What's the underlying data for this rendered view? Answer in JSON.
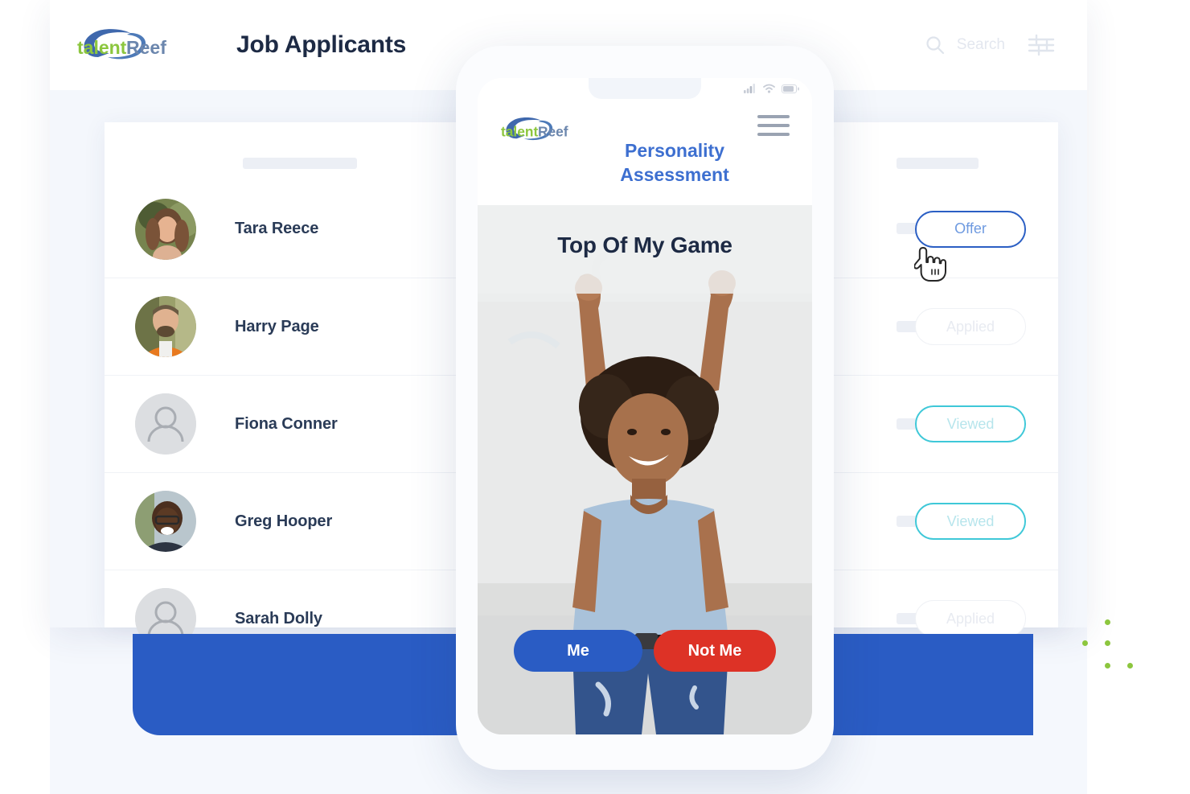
{
  "brand": {
    "logo_text_a": "talent",
    "logo_text_b": "Reef",
    "green": "#8CC63E",
    "blue": "#3f68ad",
    "gray_blue": "#6b86ad"
  },
  "header": {
    "title": "Job Applicants",
    "search_placeholder": "Search",
    "search_icon": "search-icon",
    "filter_icon": "filter-sliders-icon"
  },
  "applicants": [
    {
      "name": "Tara Reece",
      "status": "Offer",
      "status_kind": "offer",
      "avatar": "photo"
    },
    {
      "name": "Harry Page",
      "status": "Applied",
      "status_kind": "applied",
      "avatar": "photo"
    },
    {
      "name": "Fiona Conner",
      "status": "Viewed",
      "status_kind": "viewed",
      "avatar": "placeholder"
    },
    {
      "name": "Greg Hooper",
      "status": "Viewed",
      "status_kind": "viewed",
      "avatar": "photo"
    },
    {
      "name": "Sarah Dolly",
      "status": "Applied",
      "status_kind": "applied",
      "avatar": "placeholder"
    }
  ],
  "status_colors": {
    "offer": "#2B5FC4",
    "applied": "#E8EBF1",
    "viewed": "#3FC8D8"
  },
  "phone": {
    "app_title_line1": "Personality",
    "app_title_line2": "Assessment",
    "menu_icon": "hamburger-menu-icon",
    "statusbar": {
      "signal_icon": "cellular-signal-icon",
      "wifi_icon": "wifi-icon",
      "battery_icon": "battery-icon"
    },
    "question": "Top Of My Game",
    "answer_yes": "Me",
    "answer_no": "Not Me",
    "answer_yes_color": "#2A5CC4",
    "answer_no_color": "#DD3226",
    "photo_alt": "celebrating-person-photo"
  },
  "decor": {
    "banner_color": "#2A5CC4",
    "dot_color": "#8CC63E",
    "cursor_icon": "hand-pointer-cursor"
  }
}
